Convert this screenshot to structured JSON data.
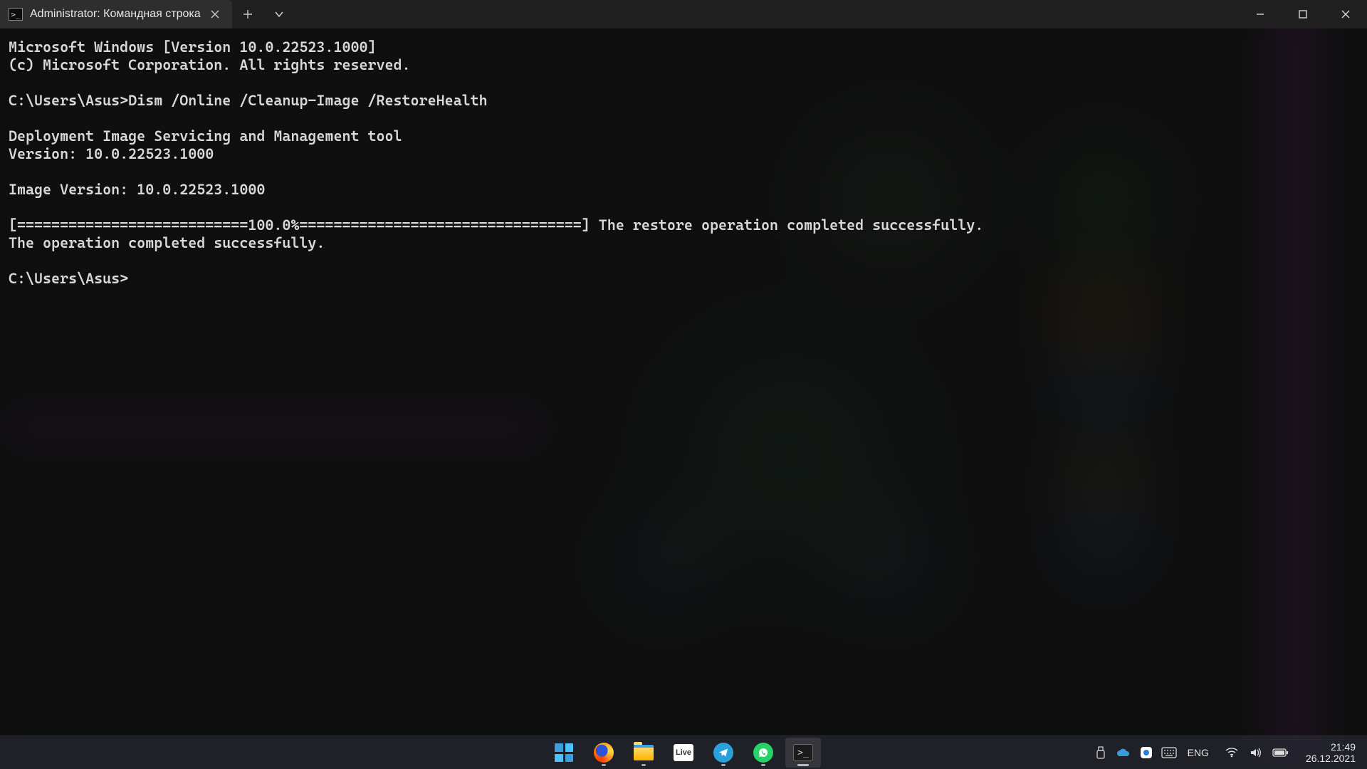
{
  "window": {
    "tab_title": "Administrator: Командная строка",
    "tab_icon_glyph": ">_"
  },
  "terminal": {
    "lines": [
      "Microsoft Windows [Version 10.0.22523.1000]",
      "(c) Microsoft Corporation. All rights reserved.",
      "",
      "C:\\Users\\Asus>Dism /Online /Cleanup-Image /RestoreHealth",
      "",
      "Deployment Image Servicing and Management tool",
      "Version: 10.0.22523.1000",
      "",
      "Image Version: 10.0.22523.1000",
      "",
      "[===========================100.0%=================================] The restore operation completed successfully.",
      "The operation completed successfully.",
      "",
      "C:\\Users\\Asus>"
    ]
  },
  "taskbar": {
    "items": [
      {
        "name": "start",
        "label": "Start"
      },
      {
        "name": "firefox",
        "label": "Firefox"
      },
      {
        "name": "explorer",
        "label": "File Explorer"
      },
      {
        "name": "live",
        "label": "Live"
      },
      {
        "name": "telegram",
        "label": "Telegram"
      },
      {
        "name": "whatsapp",
        "label": "WhatsApp"
      },
      {
        "name": "terminal",
        "label": "Terminal"
      }
    ],
    "tray": {
      "language": "ENG",
      "time": "21:49",
      "date": "26.12.2021"
    }
  }
}
